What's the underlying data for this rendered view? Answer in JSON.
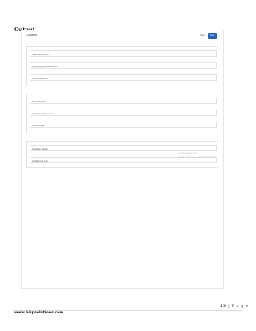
{
  "heading": "Output",
  "form": {
    "title": "Contacts",
    "new_label": "New",
    "save_label": "Save",
    "accent_color": "#1f63c8"
  },
  "contacts": [
    {
      "name": "Shivendra Singh",
      "email": "s_jsingh@xyzdomain.com",
      "phone": "(789) 56456456"
    },
    {
      "name": "Rahul Tripathi",
      "email": "rahul@example.com",
      "phone": "9123456789"
    },
    {
      "name": "Shobhan Bajpai",
      "email": "test@gmail.com"
    }
  ],
  "watermark": {
    "line1": "Activate Windows",
    "line2": "Go to Settings to activate Windows."
  },
  "footer": {
    "page_number": "13",
    "page_label": "P a g e",
    "website": "www.bispsolutions.com"
  }
}
